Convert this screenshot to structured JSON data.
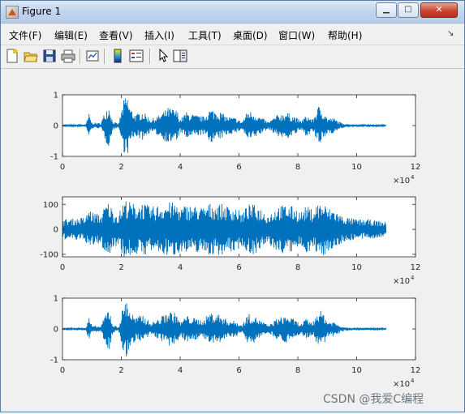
{
  "window": {
    "title": "Figure 1",
    "minimize": "▁",
    "maximize": "□",
    "close": "✕"
  },
  "menu": {
    "items": [
      "文件(F)",
      "编辑(E)",
      "查看(V)",
      "插入(I)",
      "工具(T)",
      "桌面(D)",
      "窗口(W)",
      "帮助(H)"
    ],
    "overflow_arrow": "↘"
  },
  "toolbar": {
    "tools": [
      "new-figure-icon",
      "open-file-icon",
      "save-icon",
      "print-icon",
      "link-plot-icon",
      "colorbar-icon",
      "legend-icon",
      "pointer-icon",
      "property-editor-icon"
    ]
  },
  "watermark": "CSDN @我爱C编程",
  "colors": {
    "signal": "#0072bd",
    "axes_bg": "#ffffff",
    "figure_bg": "#f0f0f0"
  },
  "chart_data": [
    {
      "type": "line",
      "title": "",
      "xlim": [
        0,
        120000
      ],
      "ylim": [
        -1,
        1
      ],
      "xticks": [
        "0",
        "2",
        "4",
        "6",
        "8",
        "10",
        "12"
      ],
      "yticks": [
        "-1",
        "0",
        "1"
      ],
      "xexponent": "×10",
      "xexponent_power": "4",
      "series": [
        {
          "x": [
            0,
            5000,
            8000,
            9000,
            10000,
            13000,
            15000,
            16000,
            17000,
            19000,
            21000,
            22000,
            23000,
            25000,
            27000,
            30000,
            33000,
            36000,
            39000,
            40000,
            42000,
            45000,
            48000,
            50000,
            53000,
            56000,
            59000,
            61000,
            63000,
            65000,
            67000,
            70000,
            73000,
            76000,
            79000,
            81000,
            83000,
            85000,
            87000,
            89000,
            90000,
            92000,
            95000,
            98000,
            101000,
            104000,
            107000,
            110000
          ],
          "envelope": [
            0.02,
            0.03,
            0.05,
            0.4,
            0.1,
            0.08,
            0.6,
            0.7,
            0.15,
            0.05,
            0.9,
            1.0,
            0.6,
            0.35,
            0.5,
            0.2,
            0.35,
            0.6,
            0.5,
            0.2,
            0.45,
            0.35,
            0.3,
            0.55,
            0.5,
            0.3,
            0.25,
            0.12,
            0.5,
            0.45,
            0.3,
            0.12,
            0.35,
            0.45,
            0.3,
            0.15,
            0.35,
            0.2,
            0.65,
            0.5,
            0.25,
            0.25,
            0.08,
            0.05,
            0.04,
            0.04,
            0.03,
            0.02
          ]
        }
      ]
    },
    {
      "type": "line",
      "title": "",
      "xlim": [
        0,
        120000
      ],
      "ylim": [
        -110,
        130
      ],
      "xticks": [
        "0",
        "2",
        "4",
        "6",
        "8",
        "10",
        "12"
      ],
      "yticks": [
        "-100",
        "0",
        "100"
      ],
      "xexponent": "×10",
      "xexponent_power": "4",
      "series": [
        {
          "x": [
            0,
            5000,
            8000,
            9000,
            10000,
            13000,
            15000,
            16000,
            17000,
            19000,
            21000,
            22000,
            23000,
            25000,
            27000,
            30000,
            33000,
            36000,
            39000,
            40000,
            42000,
            45000,
            48000,
            50000,
            53000,
            56000,
            59000,
            61000,
            63000,
            65000,
            67000,
            70000,
            73000,
            76000,
            79000,
            81000,
            83000,
            85000,
            87000,
            89000,
            90000,
            92000,
            95000,
            98000,
            101000,
            104000,
            107000,
            110000
          ],
          "envelope": [
            40,
            45,
            50,
            90,
            70,
            60,
            110,
            110,
            80,
            60,
            120,
            120,
            110,
            100,
            110,
            90,
            100,
            110,
            105,
            85,
            100,
            95,
            90,
            105,
            105,
            95,
            90,
            65,
            100,
            100,
            90,
            60,
            95,
            100,
            90,
            70,
            95,
            80,
            110,
            105,
            85,
            85,
            55,
            45,
            40,
            40,
            35,
            30
          ]
        }
      ]
    },
    {
      "type": "line",
      "title": "",
      "xlim": [
        0,
        120000
      ],
      "ylim": [
        -1,
        1
      ],
      "xticks": [
        "0",
        "2",
        "4",
        "6",
        "8",
        "10",
        "12"
      ],
      "yticks": [
        "-1",
        "0",
        "1"
      ],
      "xexponent": "×10",
      "xexponent_power": "4",
      "series": [
        {
          "x": [
            0,
            5000,
            8000,
            9000,
            10000,
            13000,
            15000,
            16000,
            17000,
            19000,
            21000,
            22000,
            23000,
            25000,
            27000,
            30000,
            33000,
            36000,
            39000,
            40000,
            42000,
            45000,
            48000,
            50000,
            53000,
            56000,
            59000,
            61000,
            63000,
            65000,
            67000,
            70000,
            73000,
            76000,
            79000,
            81000,
            83000,
            85000,
            87000,
            89000,
            90000,
            92000,
            95000,
            98000,
            101000,
            104000,
            107000,
            110000
          ],
          "envelope": [
            0.02,
            0.03,
            0.05,
            0.4,
            0.1,
            0.08,
            0.6,
            0.7,
            0.15,
            0.05,
            0.9,
            1.0,
            0.6,
            0.35,
            0.5,
            0.2,
            0.35,
            0.6,
            0.5,
            0.2,
            0.45,
            0.35,
            0.3,
            0.55,
            0.5,
            0.3,
            0.25,
            0.12,
            0.5,
            0.45,
            0.3,
            0.12,
            0.35,
            0.45,
            0.3,
            0.15,
            0.35,
            0.2,
            0.65,
            0.5,
            0.25,
            0.25,
            0.08,
            0.05,
            0.04,
            0.04,
            0.03,
            0.02
          ]
        }
      ]
    }
  ]
}
